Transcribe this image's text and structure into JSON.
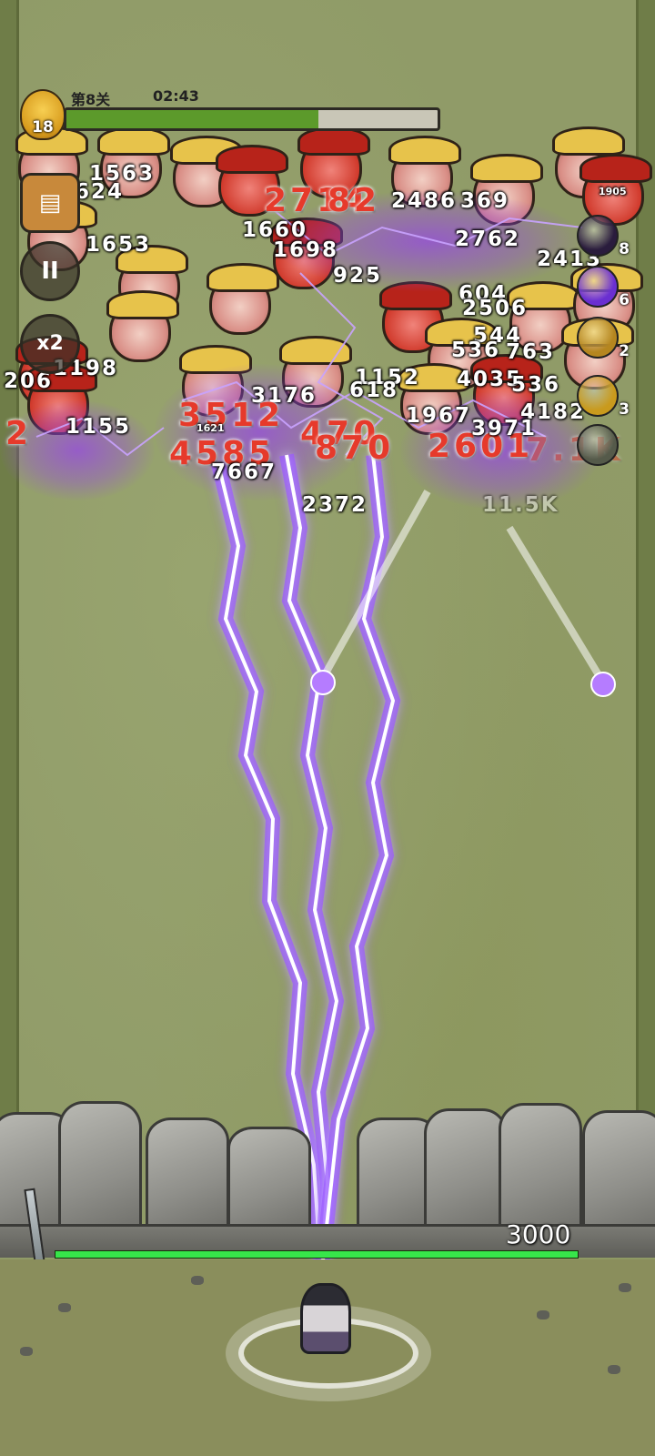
{
  "hud": {
    "stage": "第8关",
    "timer": "02:43",
    "level": "18",
    "progress": 0.68
  },
  "left_buttons": [
    {
      "name": "scroll-icon",
      "label": ""
    },
    {
      "name": "pause-icon",
      "label": "II"
    },
    {
      "name": "speed-icon",
      "label": "x2"
    }
  ],
  "skills": [
    {
      "name": "dark-orb-icon",
      "count": "8",
      "color": "#2a1c3d"
    },
    {
      "name": "lightning-icon",
      "count": "6",
      "color": "#6a2fd1"
    },
    {
      "name": "timer-icon",
      "count": "2",
      "color": "#b5861f"
    },
    {
      "name": "claw-icon",
      "count": "3",
      "color": "#c99a1d"
    },
    {
      "name": "empty-slot-icon",
      "count": "",
      "color": "#555a4a"
    }
  ],
  "damage": [
    {
      "text": "1563"
    },
    {
      "text": "624"
    },
    {
      "text": "1653"
    },
    {
      "text": "1198"
    },
    {
      "text": "206"
    },
    {
      "text": "1155"
    },
    {
      "text": "2"
    },
    {
      "text": "1660"
    },
    {
      "text": "1698"
    },
    {
      "text": "925"
    },
    {
      "text": "2486"
    },
    {
      "text": "369"
    },
    {
      "text": "2762"
    },
    {
      "text": "2413"
    },
    {
      "text": "604"
    },
    {
      "text": "2506"
    },
    {
      "text": "544"
    },
    {
      "text": "536"
    },
    {
      "text": "763"
    },
    {
      "text": "4035"
    },
    {
      "text": "536"
    },
    {
      "text": "1152"
    },
    {
      "text": "618"
    },
    {
      "text": "3176"
    },
    {
      "text": "3512"
    },
    {
      "text": "4585"
    },
    {
      "text": "7667"
    },
    {
      "text": "470"
    },
    {
      "text": "870"
    },
    {
      "text": "1967"
    },
    {
      "text": "2601"
    },
    {
      "text": "4182"
    },
    {
      "text": "3971"
    },
    {
      "text": "2372"
    },
    {
      "text": "11.5K"
    },
    {
      "text": "7.1K"
    },
    {
      "text": "2714"
    },
    {
      "text": "82"
    },
    {
      "text": "1621"
    },
    {
      "text": "1905"
    }
  ],
  "wall": {
    "hp_text": "3000",
    "hp_fraction": 1.0
  },
  "colors": {
    "bolt": "#a46bff",
    "bolt_core": "#ffffff",
    "crit": "#e63a2b"
  }
}
